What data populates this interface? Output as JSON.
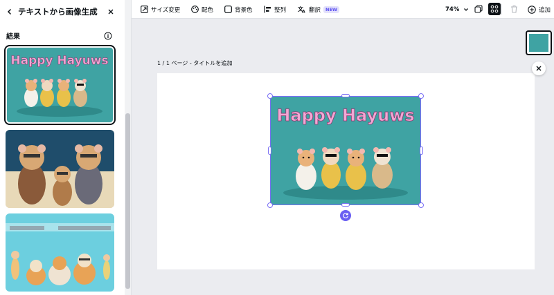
{
  "panel": {
    "title": "テキストから画像生成",
    "results_label": "結果"
  },
  "thumbnails": [
    {
      "headline": "Happy Hayuws",
      "background": "#3fa3a3"
    },
    {
      "headline": "",
      "background": "#d9c6a4"
    },
    {
      "headline": "",
      "background": "#6ccfdf"
    }
  ],
  "toolbar": {
    "resize_label": "サイズ変更",
    "color_label": "配色",
    "bg_color_label": "背景色",
    "align_label": "整列",
    "translate_label": "翻訳",
    "new_badge": "NEW",
    "zoom_value": "74%",
    "add_label": "追加"
  },
  "canvas": {
    "page_label": "1 / 1 ページ - タイトルを追加",
    "image_headline": "Happy Hayuws"
  },
  "colors": {
    "accent": "#7a6ff5",
    "image_bg": "#3fa3a3",
    "headline_pink": "#f2a7d4"
  },
  "icons": [
    "chevron-left-icon",
    "close-icon",
    "info-icon",
    "resize-icon",
    "palette-icon",
    "background-color-icon",
    "align-icon",
    "translate-icon",
    "chevron-down-icon",
    "layers-icon",
    "magic-icon",
    "trash-icon",
    "add-circle-icon",
    "rotate-icon"
  ]
}
